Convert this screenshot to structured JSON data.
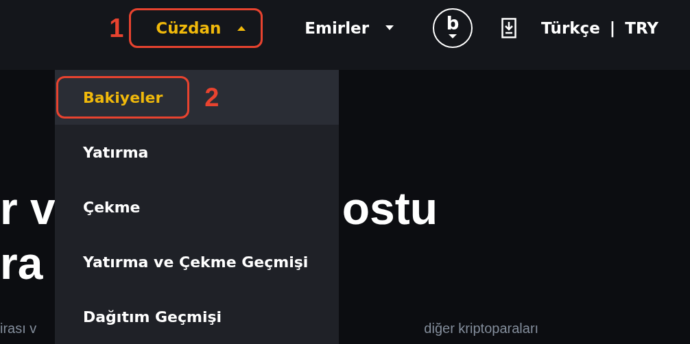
{
  "nav": [
    {
      "kind": "menu",
      "label": "Cüzdan",
      "expanded": true,
      "annotation": "1"
    },
    {
      "kind": "menu",
      "label": "Emirler",
      "expanded": false
    },
    {
      "kind": "avatar",
      "label": "b"
    },
    {
      "kind": "download"
    },
    {
      "kind": "text",
      "label": "Türkçe"
    },
    {
      "kind": "text",
      "label": "|"
    },
    {
      "kind": "text",
      "label": "TRY"
    }
  ],
  "dropdown": {
    "items": [
      {
        "label": "Bakiyeler",
        "selected": true,
        "annotation": "2"
      },
      {
        "label": "Yatırma",
        "selected": false
      },
      {
        "label": "Çekme",
        "selected": false
      },
      {
        "label": "Yatırma ve Çekme Geçmişi",
        "selected": false
      },
      {
        "label": "Dağıtım Geçmişi",
        "selected": false
      }
    ]
  },
  "hero": {
    "line_1_left": "r v",
    "line_1_right": "ostu",
    "line_2": "ra",
    "sub_left": "irası v",
    "sub_right": "diğer kriptoparaları"
  }
}
